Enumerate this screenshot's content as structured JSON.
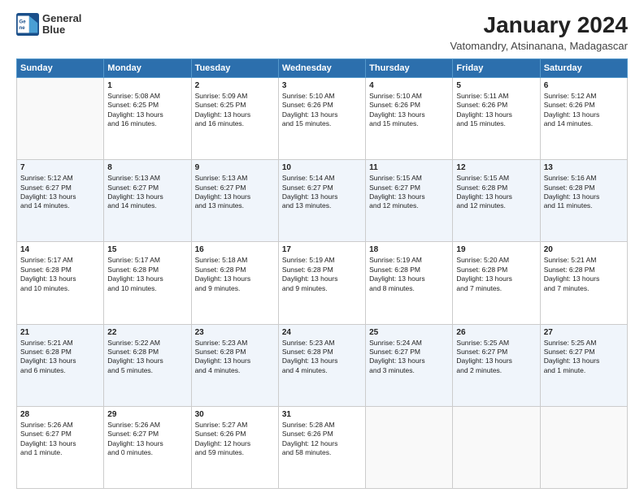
{
  "logo": {
    "line1": "General",
    "line2": "Blue"
  },
  "title": "January 2024",
  "subtitle": "Vatomandry, Atsinanana, Madagascar",
  "days_header": [
    "Sunday",
    "Monday",
    "Tuesday",
    "Wednesday",
    "Thursday",
    "Friday",
    "Saturday"
  ],
  "weeks": [
    [
      {
        "num": "",
        "info": ""
      },
      {
        "num": "1",
        "info": "Sunrise: 5:08 AM\nSunset: 6:25 PM\nDaylight: 13 hours\nand 16 minutes."
      },
      {
        "num": "2",
        "info": "Sunrise: 5:09 AM\nSunset: 6:25 PM\nDaylight: 13 hours\nand 16 minutes."
      },
      {
        "num": "3",
        "info": "Sunrise: 5:10 AM\nSunset: 6:26 PM\nDaylight: 13 hours\nand 15 minutes."
      },
      {
        "num": "4",
        "info": "Sunrise: 5:10 AM\nSunset: 6:26 PM\nDaylight: 13 hours\nand 15 minutes."
      },
      {
        "num": "5",
        "info": "Sunrise: 5:11 AM\nSunset: 6:26 PM\nDaylight: 13 hours\nand 15 minutes."
      },
      {
        "num": "6",
        "info": "Sunrise: 5:12 AM\nSunset: 6:26 PM\nDaylight: 13 hours\nand 14 minutes."
      }
    ],
    [
      {
        "num": "7",
        "info": "Sunrise: 5:12 AM\nSunset: 6:27 PM\nDaylight: 13 hours\nand 14 minutes."
      },
      {
        "num": "8",
        "info": "Sunrise: 5:13 AM\nSunset: 6:27 PM\nDaylight: 13 hours\nand 14 minutes."
      },
      {
        "num": "9",
        "info": "Sunrise: 5:13 AM\nSunset: 6:27 PM\nDaylight: 13 hours\nand 13 minutes."
      },
      {
        "num": "10",
        "info": "Sunrise: 5:14 AM\nSunset: 6:27 PM\nDaylight: 13 hours\nand 13 minutes."
      },
      {
        "num": "11",
        "info": "Sunrise: 5:15 AM\nSunset: 6:27 PM\nDaylight: 13 hours\nand 12 minutes."
      },
      {
        "num": "12",
        "info": "Sunrise: 5:15 AM\nSunset: 6:28 PM\nDaylight: 13 hours\nand 12 minutes."
      },
      {
        "num": "13",
        "info": "Sunrise: 5:16 AM\nSunset: 6:28 PM\nDaylight: 13 hours\nand 11 minutes."
      }
    ],
    [
      {
        "num": "14",
        "info": "Sunrise: 5:17 AM\nSunset: 6:28 PM\nDaylight: 13 hours\nand 10 minutes."
      },
      {
        "num": "15",
        "info": "Sunrise: 5:17 AM\nSunset: 6:28 PM\nDaylight: 13 hours\nand 10 minutes."
      },
      {
        "num": "16",
        "info": "Sunrise: 5:18 AM\nSunset: 6:28 PM\nDaylight: 13 hours\nand 9 minutes."
      },
      {
        "num": "17",
        "info": "Sunrise: 5:19 AM\nSunset: 6:28 PM\nDaylight: 13 hours\nand 9 minutes."
      },
      {
        "num": "18",
        "info": "Sunrise: 5:19 AM\nSunset: 6:28 PM\nDaylight: 13 hours\nand 8 minutes."
      },
      {
        "num": "19",
        "info": "Sunrise: 5:20 AM\nSunset: 6:28 PM\nDaylight: 13 hours\nand 7 minutes."
      },
      {
        "num": "20",
        "info": "Sunrise: 5:21 AM\nSunset: 6:28 PM\nDaylight: 13 hours\nand 7 minutes."
      }
    ],
    [
      {
        "num": "21",
        "info": "Sunrise: 5:21 AM\nSunset: 6:28 PM\nDaylight: 13 hours\nand 6 minutes."
      },
      {
        "num": "22",
        "info": "Sunrise: 5:22 AM\nSunset: 6:28 PM\nDaylight: 13 hours\nand 5 minutes."
      },
      {
        "num": "23",
        "info": "Sunrise: 5:23 AM\nSunset: 6:28 PM\nDaylight: 13 hours\nand 4 minutes."
      },
      {
        "num": "24",
        "info": "Sunrise: 5:23 AM\nSunset: 6:28 PM\nDaylight: 13 hours\nand 4 minutes."
      },
      {
        "num": "25",
        "info": "Sunrise: 5:24 AM\nSunset: 6:27 PM\nDaylight: 13 hours\nand 3 minutes."
      },
      {
        "num": "26",
        "info": "Sunrise: 5:25 AM\nSunset: 6:27 PM\nDaylight: 13 hours\nand 2 minutes."
      },
      {
        "num": "27",
        "info": "Sunrise: 5:25 AM\nSunset: 6:27 PM\nDaylight: 13 hours\nand 1 minute."
      }
    ],
    [
      {
        "num": "28",
        "info": "Sunrise: 5:26 AM\nSunset: 6:27 PM\nDaylight: 13 hours\nand 1 minute."
      },
      {
        "num": "29",
        "info": "Sunrise: 5:26 AM\nSunset: 6:27 PM\nDaylight: 13 hours\nand 0 minutes."
      },
      {
        "num": "30",
        "info": "Sunrise: 5:27 AM\nSunset: 6:26 PM\nDaylight: 12 hours\nand 59 minutes."
      },
      {
        "num": "31",
        "info": "Sunrise: 5:28 AM\nSunset: 6:26 PM\nDaylight: 12 hours\nand 58 minutes."
      },
      {
        "num": "",
        "info": ""
      },
      {
        "num": "",
        "info": ""
      },
      {
        "num": "",
        "info": ""
      }
    ]
  ]
}
